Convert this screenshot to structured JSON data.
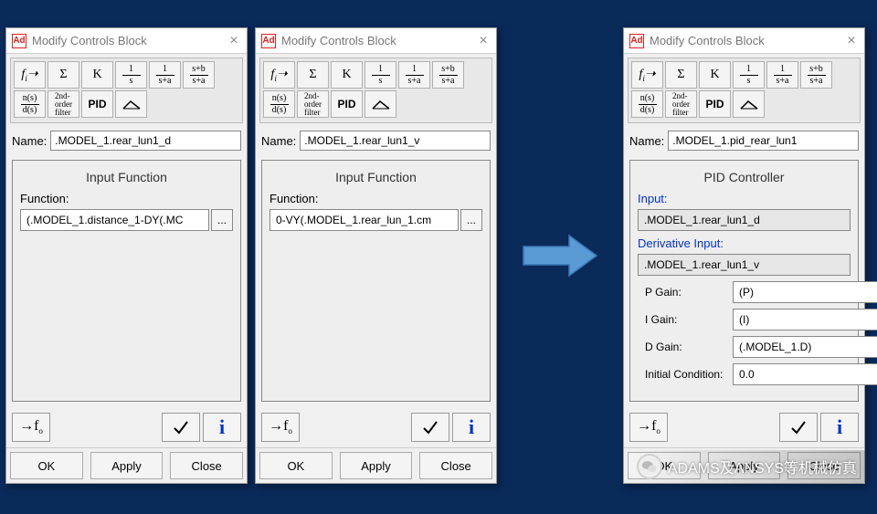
{
  "common": {
    "window_title": "Modify Controls Block",
    "app_icon_text": "Ad",
    "name_label": "Name:",
    "ok_label": "OK",
    "apply_label": "Apply",
    "close_label": "Close",
    "ellipsis": "...",
    "check_glyph": "✓",
    "info_glyph": "i",
    "close_glyph": "×",
    "toolbar_r1": [
      "fᵢ➝",
      "Σ",
      "K",
      "1/s",
      "1/(s+a)",
      "(s+b)/(s+a)"
    ],
    "toolbar_r2": [
      "n(s)/d(s)",
      "2nd-order filter",
      "PID",
      "slope"
    ]
  },
  "dlg1": {
    "name_value": ".MODEL_1.rear_lun1_d",
    "section_title": "Input Function",
    "function_label": "Function:",
    "function_value": "(.MODEL_1.distance_1-DY(.MC"
  },
  "dlg2": {
    "name_value": ".MODEL_1.rear_lun1_v",
    "section_title": "Input Function",
    "function_label": "Function:",
    "function_value": "0-VY(.MODEL_1.rear_lun_1.cm"
  },
  "dlg3": {
    "name_value": ".MODEL_1.pid_rear_lun1",
    "section_title": "PID Controller",
    "input_label": "Input:",
    "input_value": ".MODEL_1.rear_lun1_d",
    "deriv_label": "Derivative Input:",
    "deriv_value": ".MODEL_1.rear_lun1_v",
    "p_label": "P Gain:",
    "p_value": "(P)",
    "i_label": "I Gain:",
    "i_value": "(I)",
    "d_label": "D Gain:",
    "d_value": "(.MODEL_1.D)",
    "init_label": "Initial Condition:",
    "init_value": "0.0"
  },
  "watermark": "ADAMS及ANSYS等机械仿真"
}
